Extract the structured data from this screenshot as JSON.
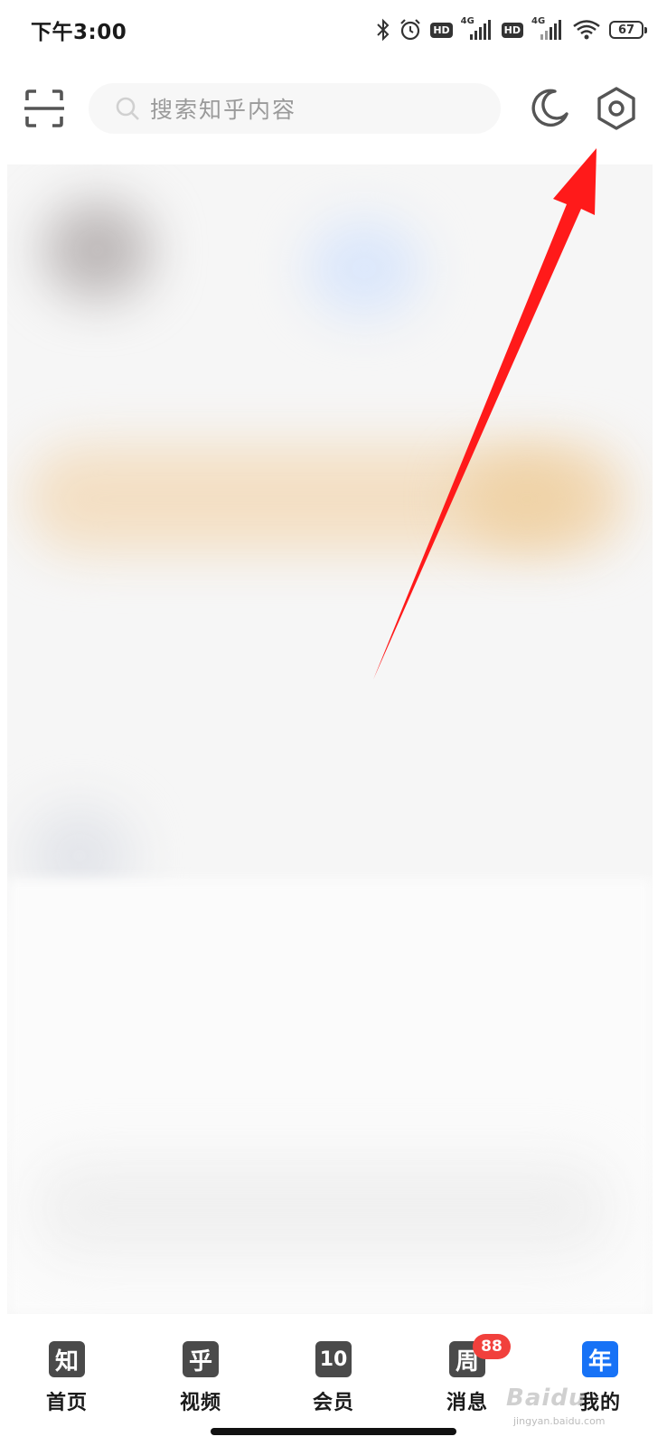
{
  "status_bar": {
    "time": "下午3:00",
    "hd_label": "HD",
    "network": "4G",
    "battery": "67",
    "icons": [
      "bluetooth-icon",
      "alarm-icon",
      "hd-icon",
      "signal-icon",
      "hd-icon",
      "signal-icon",
      "wifi-icon",
      "battery-icon"
    ]
  },
  "header": {
    "search_placeholder": "搜索知乎内容",
    "icons": [
      "scan-icon",
      "search-icon",
      "moon-icon",
      "settings-icon"
    ]
  },
  "bottom_nav": {
    "items": [
      {
        "glyph": "知",
        "label": "首页"
      },
      {
        "glyph": "乎",
        "label": "视频"
      },
      {
        "glyph": "10",
        "label": "会员"
      },
      {
        "glyph": "周",
        "label": "消息",
        "badge": "88"
      },
      {
        "glyph": "年",
        "label": "我的"
      }
    ]
  },
  "annotation": {
    "arrow_color": "#ff1a1a"
  },
  "colors": {
    "accent": "#1772f6",
    "badge": "#f1403c"
  },
  "watermark": {
    "brand": "Baidu",
    "sub": "jingyan.baidu.com"
  }
}
